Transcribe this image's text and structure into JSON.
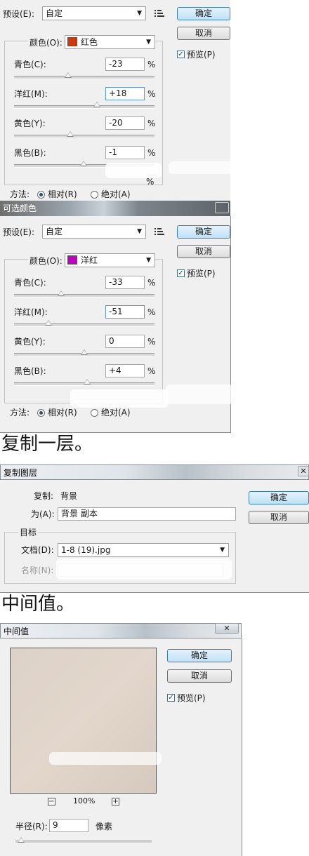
{
  "dialog1": {
    "preset_label": "预设(E):",
    "preset_value": "自定",
    "ok": "确定",
    "cancel": "取消",
    "preview_label": "预览(P)",
    "preview_checked": true,
    "color_label": "颜色(O):",
    "color_value": "红色",
    "color_swatch": "#cc3a0c",
    "sliders": [
      {
        "label": "青色(C):",
        "value": "-23",
        "level": -23
      },
      {
        "label": "洋红(M):",
        "value": "+18",
        "level": 18
      },
      {
        "label": "黄色(Y):",
        "value": "-20",
        "level": -20
      },
      {
        "label": "黑色(B):",
        "value": "-1",
        "level": -1
      }
    ],
    "percent": "%",
    "method_label": "方法:",
    "method_relative": "相对(R)",
    "method_absolute": "绝对(A)",
    "method_selected": "relative"
  },
  "dialog2": {
    "title": "可选颜色",
    "preset_label": "预设(E):",
    "preset_value": "自定",
    "ok": "确定",
    "cancel": "取消",
    "preview_label": "预览(P)",
    "preview_checked": true,
    "color_label": "颜色(O):",
    "color_value": "洋红",
    "color_swatch": "#c000c0",
    "sliders": [
      {
        "label": "青色(C):",
        "value": "-33",
        "level": -33
      },
      {
        "label": "洋红(M):",
        "value": "-51",
        "level": -51
      },
      {
        "label": "黄色(Y):",
        "value": "0",
        "level": 0
      },
      {
        "label": "黑色(B):",
        "value": "+4",
        "level": 4
      }
    ],
    "percent": "%",
    "method_label": "方法:",
    "method_relative": "相对(R)",
    "method_absolute": "绝对(A)",
    "method_selected": "relative"
  },
  "caption1": "复制一层。",
  "dialog3": {
    "title": "复制图层",
    "close": "✕",
    "copy_label": "复制:",
    "copy_value": "背景",
    "as_label": "为(A):",
    "as_value": "背景 副本",
    "ok": "确定",
    "cancel": "取消",
    "target_label": "目标",
    "document_label": "文档(D):",
    "document_value": "1-8 (19).jpg",
    "name_label": "名称(N):"
  },
  "caption2": "中间值。",
  "dialog4": {
    "title": "中间值",
    "close": "✕",
    "ok": "确定",
    "cancel": "取消",
    "preview_label": "预览(P)",
    "preview_checked": true,
    "zoom_minus": "−",
    "zoom_value": "100%",
    "zoom_plus": "+",
    "radius_label": "半径(R):",
    "radius_value": "9",
    "radius_unit": "像素"
  }
}
